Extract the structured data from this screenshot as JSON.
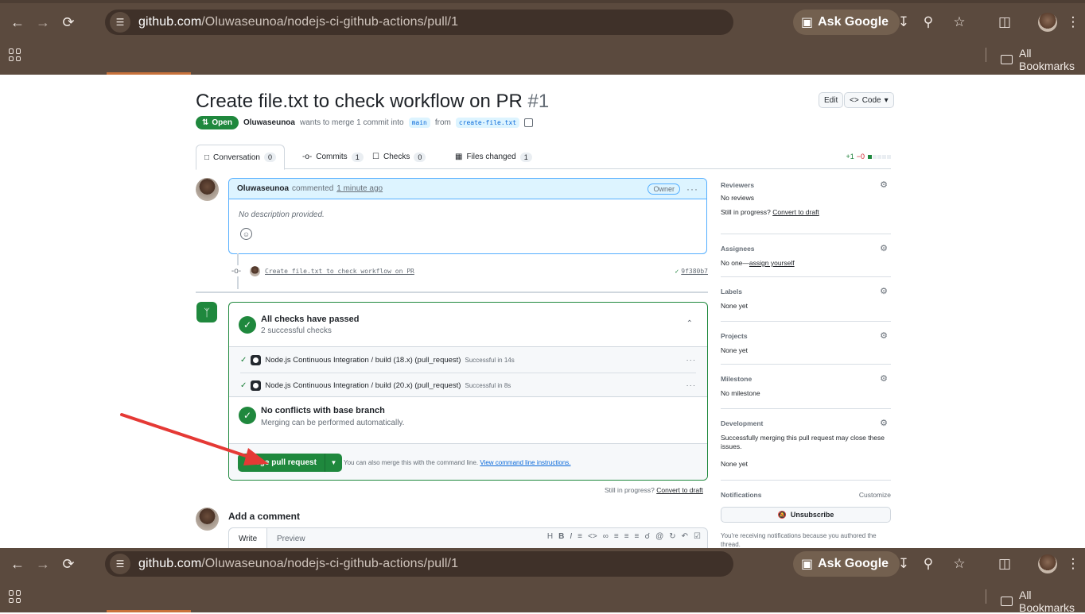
{
  "browser": {
    "url_domain": "github.com",
    "url_path": "/Oluwaseunoa/nodejs-ci-github-actions/pull/1",
    "ask_google_label": "Ask Google",
    "bookmarks_label": "All Bookmarks"
  },
  "pr": {
    "title": "Create file.txt to check workflow on PR",
    "number": "#1",
    "edit_label": "Edit",
    "code_label": "Code",
    "state": "Open",
    "author": "Oluwaseunoa",
    "merge_text": "wants to merge 1 commit into",
    "base_branch": "main",
    "from_text": "from",
    "head_branch": "create-file.txt"
  },
  "tabs": [
    {
      "label": "Conversation",
      "count": "0"
    },
    {
      "label": "Commits",
      "count": "1"
    },
    {
      "label": "Checks",
      "count": "0"
    },
    {
      "label": "Files changed",
      "count": "1"
    }
  ],
  "diffstat": {
    "add": "+1",
    "del": "−0"
  },
  "comment": {
    "author": "Oluwaseunoa",
    "action": "commented",
    "time": "1 minute ago",
    "role": "Owner",
    "body": "No description provided."
  },
  "commit": {
    "message": "Create file.txt to check workflow on PR",
    "sha": "9f380b7"
  },
  "mergebox": {
    "checks_title": "All checks have passed",
    "checks_sub": "2 successful checks",
    "checks": [
      {
        "name": "Node.js Continuous Integration / build (18.x) (pull_request)",
        "status": "Successful in 14s"
      },
      {
        "name": "Node.js Continuous Integration / build (20.x) (pull_request)",
        "status": "Successful in 8s"
      }
    ],
    "conflicts_title": "No conflicts with base branch",
    "conflicts_sub": "Merging can be performed automatically.",
    "merge_button": "Merge pull request",
    "cli_text": "You can also merge this with the command line.",
    "cli_link": "View command line instructions."
  },
  "still_in_progress": "Still in progress?",
  "convert_to_draft": "Convert to draft",
  "add_comment": {
    "title": "Add a comment",
    "write_tab": "Write",
    "preview_tab": "Preview"
  },
  "sidebar": {
    "reviewers": {
      "title": "Reviewers",
      "value": "No reviews",
      "extra": "Still in progress?",
      "extra_link": "Convert to draft"
    },
    "assignees": {
      "title": "Assignees",
      "value": "No one—",
      "link": "assign yourself"
    },
    "labels": {
      "title": "Labels",
      "value": "None yet"
    },
    "projects": {
      "title": "Projects",
      "value": "None yet"
    },
    "milestone": {
      "title": "Milestone",
      "value": "No milestone"
    },
    "development": {
      "title": "Development",
      "value": "Successfully merging this pull request may close these issues.",
      "extra": "None yet"
    },
    "notifications": {
      "title": "Notifications",
      "customize": "Customize",
      "button": "Unsubscribe",
      "note": "You're receiving notifications because you authored the thread."
    }
  }
}
